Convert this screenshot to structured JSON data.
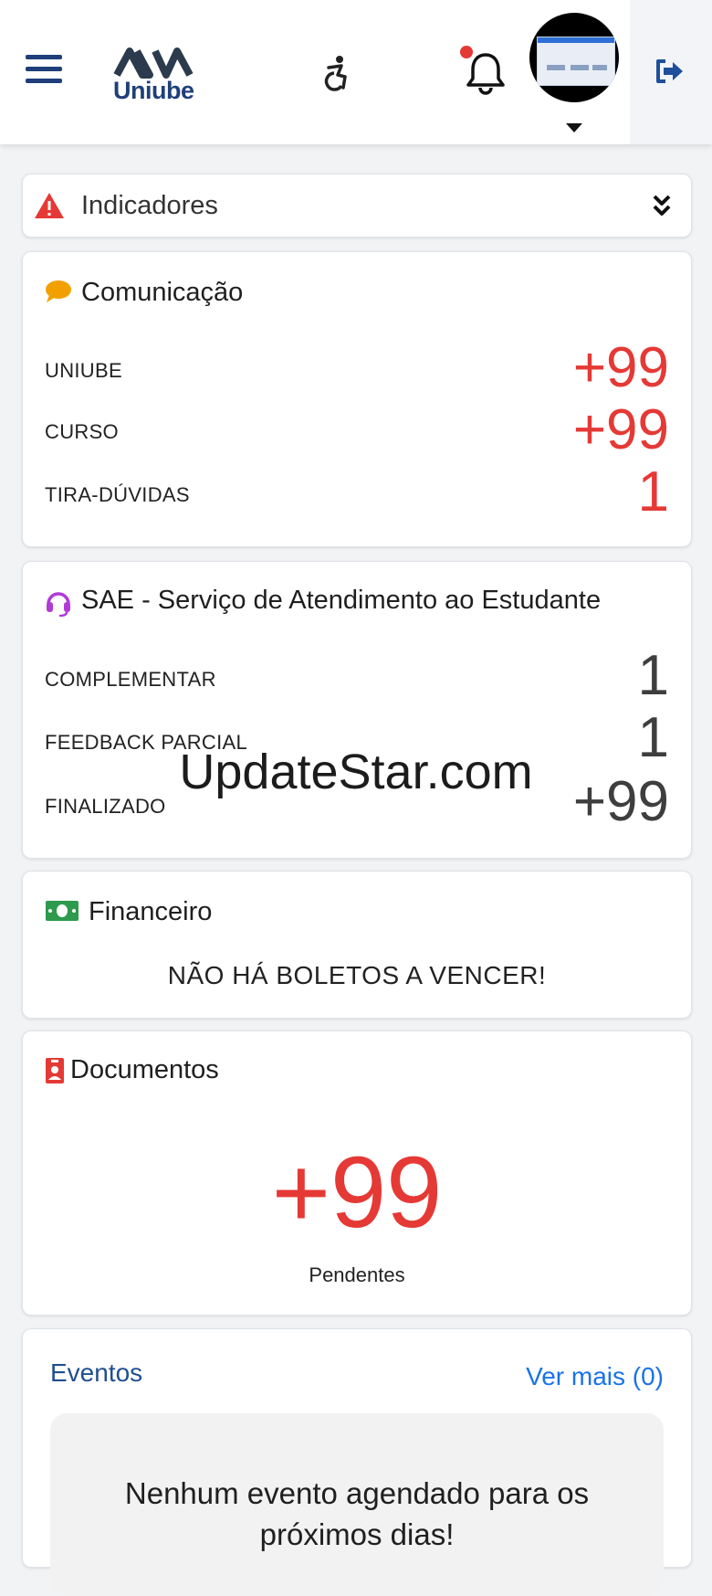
{
  "header": {
    "logo_text": "Uniube",
    "logo_wordmark": "AVA"
  },
  "indicadores": {
    "label": "Indicadores"
  },
  "comunicacao": {
    "title": "Comunicação",
    "rows": [
      {
        "label": "UNIUBE",
        "value": "+99"
      },
      {
        "label": "CURSO",
        "value": "+99"
      },
      {
        "label": "TIRA-DÚVIDAS",
        "value": "1"
      }
    ]
  },
  "sae": {
    "title": "SAE - Serviço de Atendimento ao Estudante",
    "rows": [
      {
        "label": "COMPLEMENTAR",
        "value": "1"
      },
      {
        "label": "FEEDBACK PARCIAL",
        "value": "1"
      },
      {
        "label": "FINALIZADO",
        "value": "+99"
      }
    ]
  },
  "financeiro": {
    "title": "Financeiro",
    "message": "NÃO HÁ BOLETOS A VENCER!"
  },
  "documentos": {
    "title": "Documentos",
    "count": "+99",
    "subtitle": "Pendentes"
  },
  "eventos": {
    "title": "Eventos",
    "more": "Ver mais (0)",
    "empty_line1": "Nenhum evento agendado para os",
    "empty_line2": "próximos dias!"
  },
  "watermark": "UpdateStar.com",
  "colors": {
    "brand": "#1f3f7a",
    "accent_red": "#e53935",
    "link": "#1a73e8",
    "chat_icon": "#f2a000",
    "sae_icon": "#b23ad6",
    "money_icon": "#2e9a4e"
  }
}
